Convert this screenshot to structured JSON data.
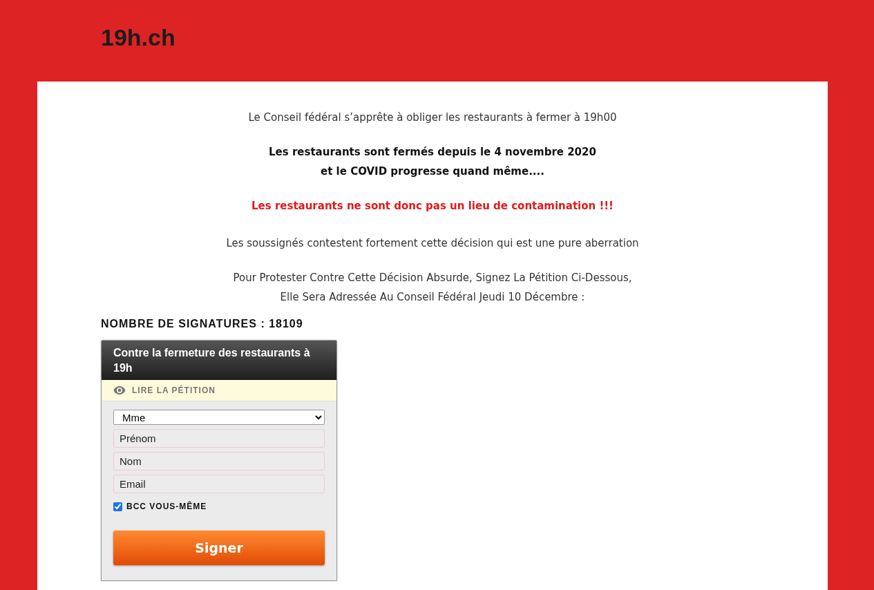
{
  "header": {
    "logo": "19h.ch"
  },
  "paragraphs": [
    {
      "kind": "plain",
      "lines": [
        "Le Conseil fédéral s’apprête à obliger les restaurants à fermer à 19h00"
      ]
    },
    {
      "kind": "bold",
      "lines": [
        "Les restaurants sont fermés depuis le 4 novembre 2020",
        "et le COVID progresse quand même...."
      ]
    },
    {
      "kind": "alert",
      "lines": [
        "Les restaurants ne sont donc pas un lieu de contamination !!!"
      ]
    },
    {
      "kind": "plain",
      "lines": [
        "Les soussignés contestent fortement cette décision qui est une pure aberration"
      ]
    },
    {
      "kind": "plain",
      "lines": [
        "Pour Protester Contre Cette Décision Absurde, Signez La Pétition Ci-Dessous,",
        "Elle Sera Adressée Au Conseil Fédéral Jeudi 10 Décembre :"
      ]
    }
  ],
  "signature_count": "NOMBRE DE SIGNATURES : 18109",
  "petition": {
    "title": "Contre la fermeture des restaurants à 19h",
    "read_link": "LIRE LA PÉTITION",
    "salutation": {
      "value": "Mme"
    },
    "fields": [
      {
        "placeholder": "Prénom"
      },
      {
        "placeholder": "Nom"
      },
      {
        "placeholder": "Email"
      }
    ],
    "bcc": {
      "label": "BCC VOUS-MÊME",
      "checked": true
    },
    "submit": "Signer"
  }
}
